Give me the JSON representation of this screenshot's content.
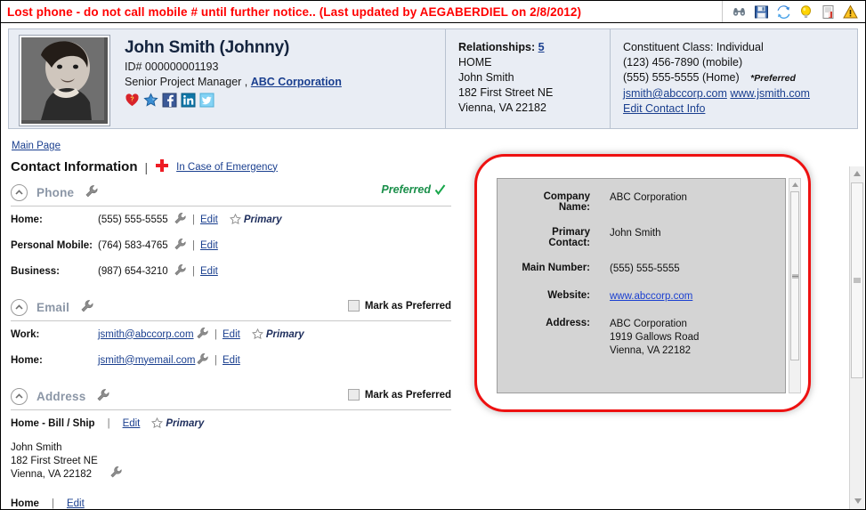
{
  "alert": {
    "message": "Lost phone - do not call mobile # until further notice.. (Last updated by AEGABERDIEL on 2/8/2012)",
    "icons": [
      "binoculars-icon",
      "save-icon",
      "refresh-icon",
      "lightbulb-icon",
      "document-icon",
      "warning-icon"
    ]
  },
  "profile": {
    "name": "John Smith (Johnny)",
    "id_label": "ID# 000000001193",
    "title": "Senior Project Manager ,",
    "company_link": "ABC Corporation",
    "social_icons": [
      "heart-question-icon",
      "star-icon",
      "facebook-icon",
      "linkedin-icon",
      "twitter-icon"
    ]
  },
  "relationships": {
    "heading": "Relationships:",
    "count": "5",
    "lines": [
      "HOME",
      "John Smith",
      "182 First Street NE",
      "Vienna, VA 22182"
    ]
  },
  "constituent": {
    "class_line": "Constituent Class: Individual",
    "mobile": "(123) 456-7890 (mobile)",
    "home": "(555) 555-5555 (Home)",
    "preferred_note": "*Preferred",
    "email_link": "jsmith@abccorp.com",
    "website_link": "www.jsmith.com",
    "edit_link": "Edit Contact Info"
  },
  "breadcrumb": {
    "main_page": "Main Page"
  },
  "contact_info": {
    "title": "Contact Information",
    "separator": "|",
    "ice_link": "In Case of Emergency"
  },
  "phone_section": {
    "name": "Phone",
    "preferred_label": "Preferred",
    "rows": [
      {
        "label": "Home:",
        "value": "(555) 555-5555",
        "edit": "Edit",
        "primary": "Primary",
        "has_primary": true
      },
      {
        "label": "Personal Mobile:",
        "value": "(764) 583-4765",
        "edit": "Edit",
        "primary": "",
        "has_primary": false
      },
      {
        "label": "Business:",
        "value": "(987) 654-3210",
        "edit": "Edit",
        "primary": "",
        "has_primary": false
      }
    ]
  },
  "email_section": {
    "name": "Email",
    "mark_preferred": "Mark as Preferred",
    "rows": [
      {
        "label": "Work:",
        "value": "jsmith@abccorp.com",
        "edit": "Edit",
        "primary": "Primary",
        "has_primary": true
      },
      {
        "label": "Home:",
        "value": "jsmith@myemail.com",
        "edit": "Edit",
        "primary": "",
        "has_primary": false
      }
    ]
  },
  "address_section": {
    "name": "Address",
    "mark_preferred": "Mark as Preferred",
    "type_label": "Home - Bill / Ship",
    "edit": "Edit",
    "primary": "Primary",
    "lines": [
      "John Smith",
      "182 First Street NE",
      "Vienna, VA 22182"
    ],
    "footer_label": "Home",
    "footer_edit": "Edit"
  },
  "callout": {
    "rows": [
      {
        "label": "Company Name:",
        "value": "ABC Corporation",
        "is_link": false
      },
      {
        "label": "Primary Contact:",
        "value": "John Smith",
        "is_link": false
      },
      {
        "label": "Main Number:",
        "value": "(555) 555-5555",
        "is_link": false
      },
      {
        "label": "Website:",
        "value": "www.abccorp.com",
        "is_link": true
      }
    ],
    "address_label": "Address:",
    "address_lines": [
      "ABC Corporation",
      "1919 Gallows Road",
      "Vienna, VA 22182"
    ]
  },
  "colors": {
    "alert_red": "#ff0000",
    "link_blue": "#1a3f8f",
    "header_bg": "#e9edf4",
    "section_gray": "#8b96a6",
    "preferred_green": "#1a8f4a",
    "callout_red": "#ee1111",
    "callout_bg": "#d4d4d4"
  }
}
